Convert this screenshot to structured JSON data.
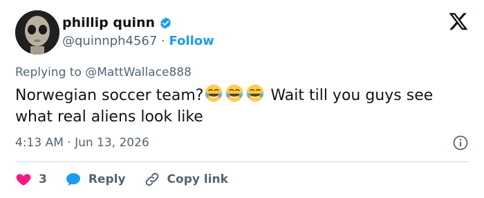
{
  "author": {
    "name": "phillip quinn",
    "handle": "@quinnph4567",
    "separator": "·",
    "follow_label": "Follow"
  },
  "reply_context": {
    "prefix": "Replying to",
    "mention": "@MattWallace888"
  },
  "tweet": {
    "text_before_emoji": "Norwegian soccer team?",
    "emoji_count": 3,
    "emoji_name": "face-with-tears-of-joy",
    "text_after_emoji": " Wait till you guys see what real aliens look like"
  },
  "meta": {
    "timestamp": "4:13 AM · Jun 13, 2026"
  },
  "actions": {
    "like_count": "3",
    "reply_label": "Reply",
    "copy_link_label": "Copy link"
  },
  "colors": {
    "accent": "#1d9bf0",
    "like": "#f91880",
    "muted_text": "#536471",
    "divider": "#cfd9de"
  }
}
